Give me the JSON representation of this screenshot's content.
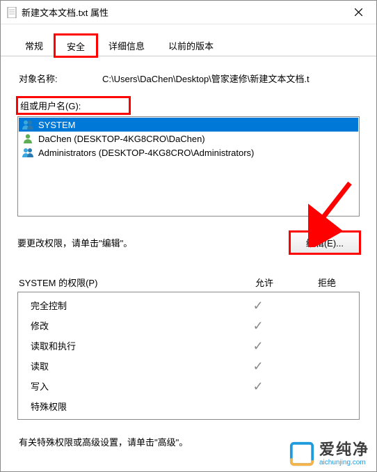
{
  "window": {
    "title": "新建文本文档.txt 属性"
  },
  "tabs": {
    "general": "常规",
    "security": "安全",
    "details": "详细信息",
    "previous": "以前的版本"
  },
  "object": {
    "label": "对象名称:",
    "value": "C:\\Users\\DaChen\\Desktop\\管家速修\\新建文本文档.t"
  },
  "groups": {
    "label": "组或用户名(G):",
    "items": [
      {
        "icon": "users-icon",
        "label": "SYSTEM",
        "selected": true
      },
      {
        "icon": "user-icon",
        "label": "DaChen (DESKTOP-4KG8CRO\\DaChen)",
        "selected": false
      },
      {
        "icon": "users-icon",
        "label": "Administrators (DESKTOP-4KG8CRO\\Administrators)",
        "selected": false
      }
    ]
  },
  "edit": {
    "hint": "要更改权限，请单击\"编辑\"。",
    "button": "编辑(E)..."
  },
  "permissions": {
    "header_name": "SYSTEM 的权限(P)",
    "col_allow": "允许",
    "col_deny": "拒绝",
    "rows": [
      {
        "name": "完全控制",
        "allow": true,
        "deny": false
      },
      {
        "name": "修改",
        "allow": true,
        "deny": false
      },
      {
        "name": "读取和执行",
        "allow": true,
        "deny": false
      },
      {
        "name": "读取",
        "allow": true,
        "deny": false
      },
      {
        "name": "写入",
        "allow": true,
        "deny": false
      },
      {
        "name": "特殊权限",
        "allow": false,
        "deny": false
      }
    ]
  },
  "footer": {
    "text": "有关特殊权限或高级设置，请单击\"高级\"。"
  },
  "watermark": {
    "main": "爱纯净",
    "sub": "aichunjing.com"
  }
}
